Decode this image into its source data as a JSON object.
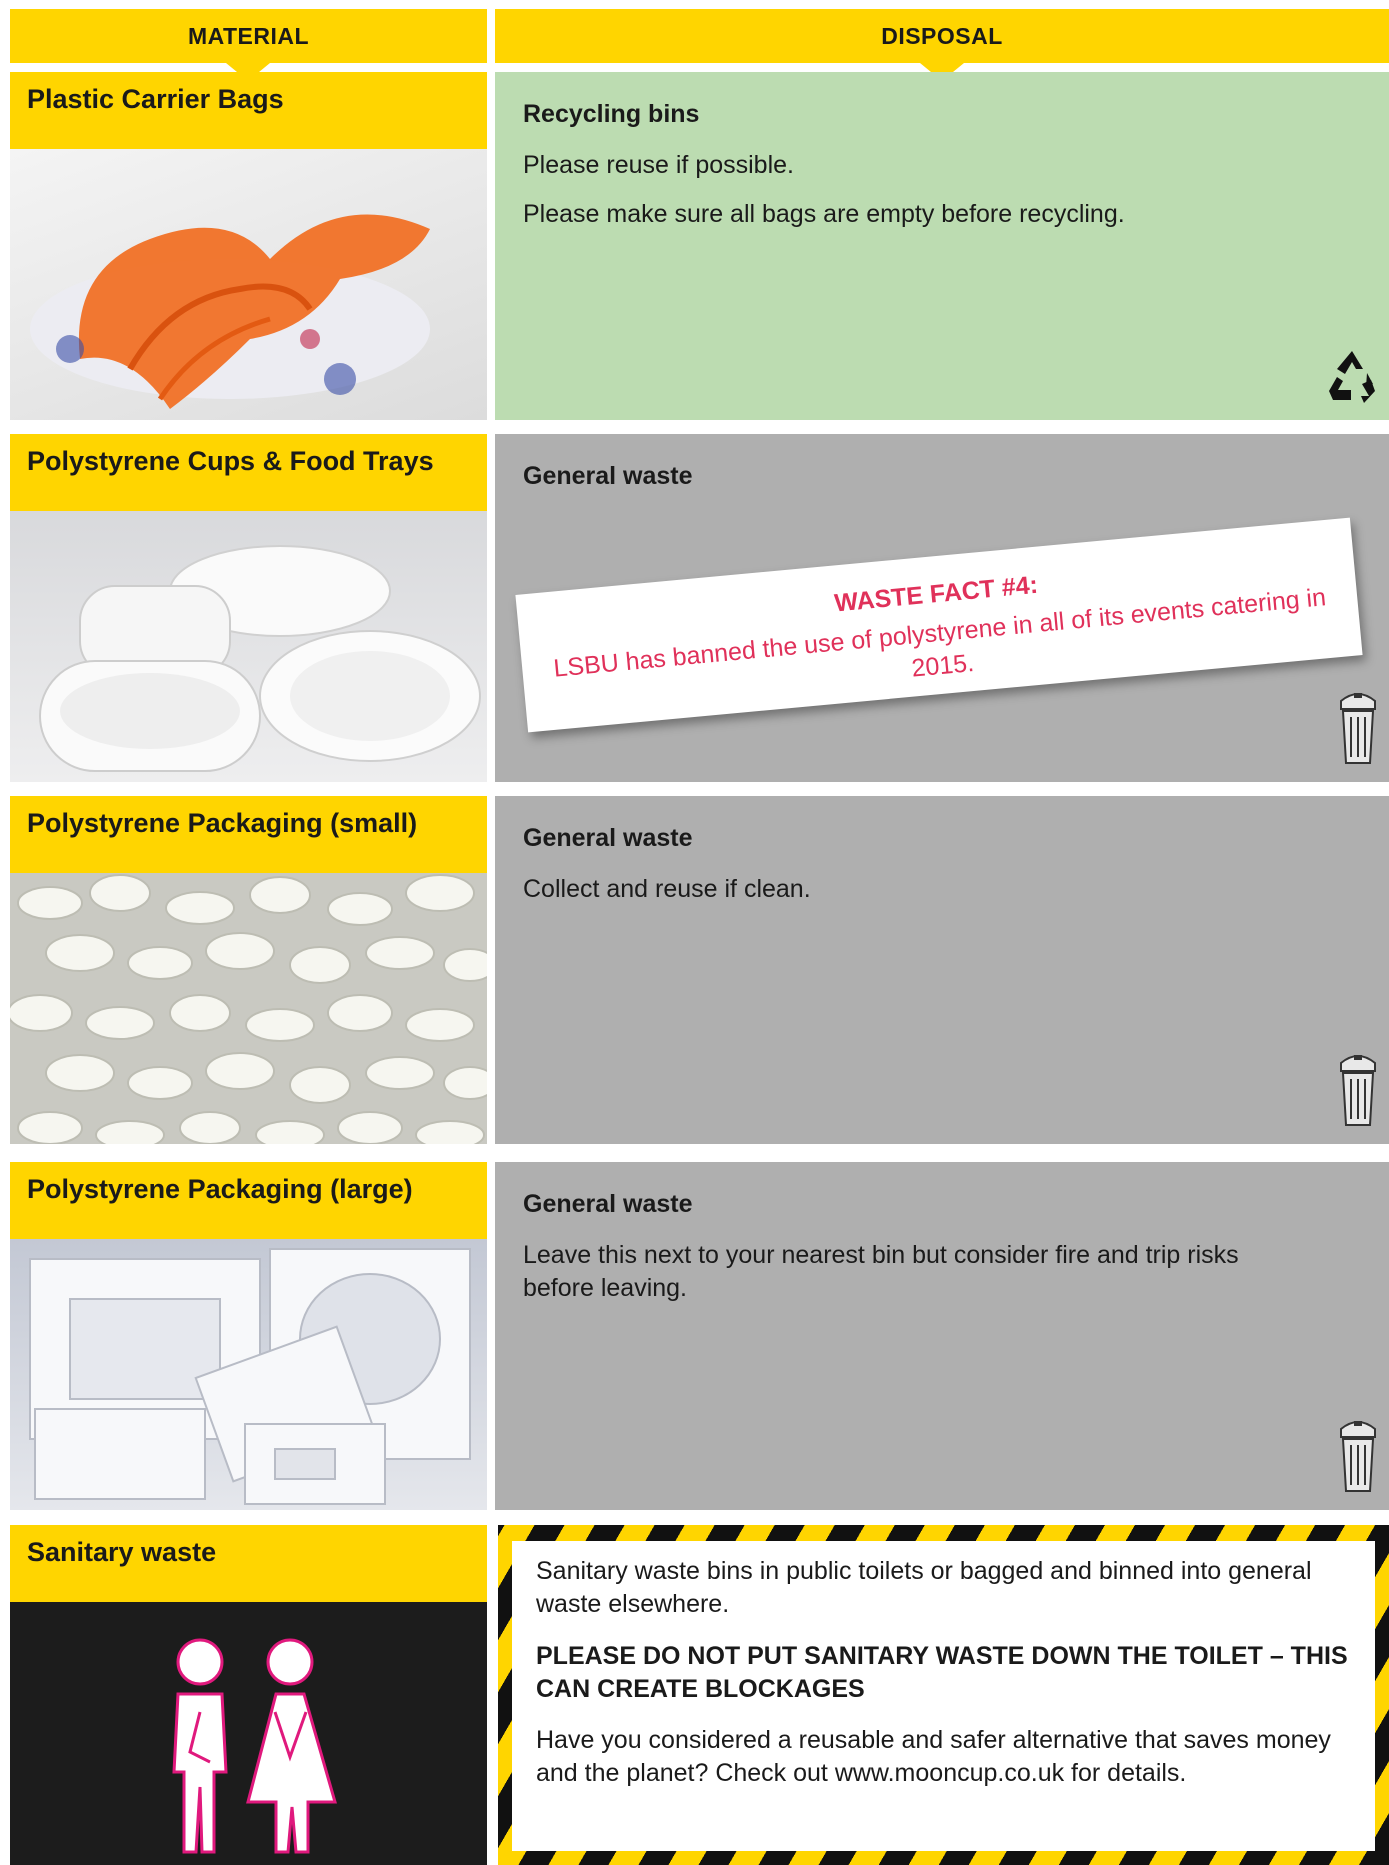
{
  "header": {
    "material": "MATERIAL",
    "disposal": "DISPOSAL"
  },
  "rows": [
    {
      "material": "Plastic Carrier Bags",
      "disposal_title": "Recycling bins",
      "lines": [
        "Please reuse if possible.",
        "Please make sure all bags are empty before recycling."
      ],
      "icon": "recycle-icon"
    },
    {
      "material": "Polystyrene Cups & Food Trays",
      "disposal_title": "General waste",
      "fact": {
        "title": "WASTE FACT #4:",
        "text": "LSBU has banned the use of polystyrene in all of its events catering in 2015."
      },
      "icon": "trash-bin-icon"
    },
    {
      "material": "Polystyrene Packaging (small)",
      "disposal_title": "General waste",
      "lines": [
        "Collect and reuse if clean."
      ],
      "icon": "trash-bin-icon"
    },
    {
      "material": "Polystyrene Packaging (large)",
      "disposal_title": "General waste",
      "lines": [
        "Leave this next to your nearest bin but consider fire and trip risks before leaving."
      ],
      "icon": "trash-bin-icon"
    },
    {
      "material": "Sanitary waste",
      "lines": [
        "Sanitary waste bins in public toilets or bagged and binned into general waste elsewhere.",
        "PLEASE DO NOT PUT SANITARY WASTE DOWN THE TOILET – THIS CAN CREATE BLOCKAGES",
        "Have you considered a reusable and safer alternative that saves money and the planet? Check out www.mooncup.co.uk for details."
      ],
      "icon": "toilet-people-icon"
    }
  ],
  "colors": {
    "yellow": "#ffd500",
    "green": "#bcdcb1",
    "grey": "#afafaf",
    "fact_red": "#e0315a"
  }
}
